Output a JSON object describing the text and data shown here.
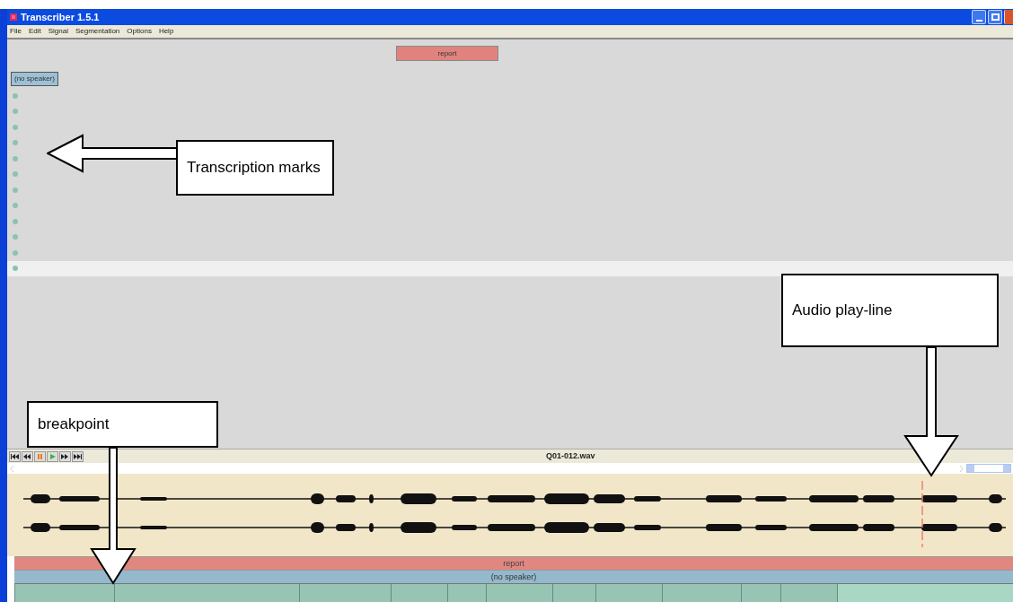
{
  "window": {
    "title": "Transcriber 1.5.1"
  },
  "menu": [
    "File",
    "Edit",
    "Signal",
    "Segmentation",
    "Options",
    "Help"
  ],
  "section_button": "report",
  "speaker_button": "(no speaker)",
  "transcription_rows": [
    {
      "selected": false
    },
    {
      "selected": false
    },
    {
      "selected": false
    },
    {
      "selected": false
    },
    {
      "selected": false
    },
    {
      "selected": false
    },
    {
      "selected": false
    },
    {
      "selected": false
    },
    {
      "selected": false
    },
    {
      "selected": false
    },
    {
      "selected": false
    },
    {
      "selected": true
    }
  ],
  "audio": {
    "filename": "Q01-012.wav"
  },
  "timeline": {
    "section": "report",
    "speaker": "(no speaker)",
    "segments": [
      {
        "selected": false
      },
      {
        "selected": false
      },
      {
        "selected": false
      },
      {
        "selected": false
      },
      {
        "selected": false
      },
      {
        "selected": false
      },
      {
        "selected": false
      },
      {
        "selected": false
      },
      {
        "selected": false
      },
      {
        "selected": false
      },
      {
        "selected": false
      },
      {
        "selected": true
      }
    ]
  },
  "callouts": [
    {
      "kind": "left",
      "label": "Transcription marks"
    },
    {
      "kind": "down-right",
      "label": "Audio play-line"
    },
    {
      "kind": "down-left",
      "label": "breakpoint"
    }
  ]
}
